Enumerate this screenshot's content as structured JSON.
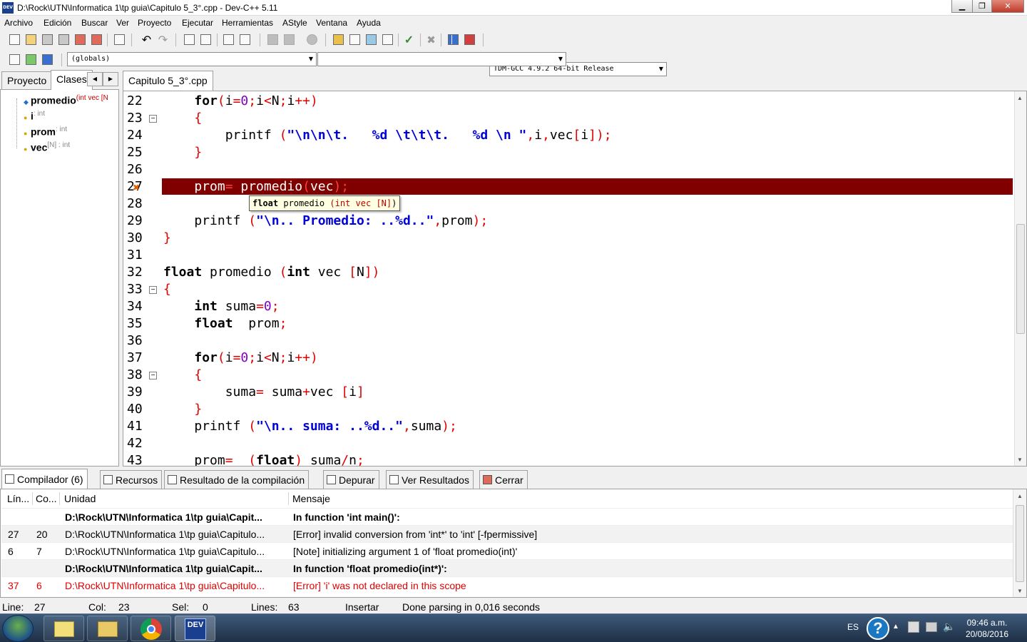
{
  "window": {
    "title": "D:\\Rock\\UTN\\Informatica 1\\tp guia\\Capitulo 5_3°.cpp - Dev-C++ 5.11",
    "app_icon_label": "DEV",
    "minimize": "▁",
    "maximize": "❐",
    "close": "✕"
  },
  "menu": [
    "Archivo",
    "Edición",
    "Buscar",
    "Ver",
    "Proyecto",
    "Ejecutar",
    "Herramientas",
    "AStyle",
    "Ventana",
    "Ayuda"
  ],
  "toolbar": {
    "compiler_select": "TDM-GCC 4.9.2 64-bit Release",
    "scope_select": "(globals)",
    "function_select": ""
  },
  "left_panel": {
    "tabs": [
      "Proyecto",
      "Clases"
    ],
    "items": [
      {
        "name": "promedio",
        "detail": "(int vec [N"
      },
      {
        "name": "i",
        "detail": ": int"
      },
      {
        "name": "prom",
        "detail": ": int"
      },
      {
        "name": "vec",
        "detail": "[N] : int"
      }
    ]
  },
  "editor": {
    "tab_label": "Capitulo 5_3°.cpp",
    "line_numbers": [
      "22",
      "23",
      "24",
      "25",
      "26",
      "27",
      "28",
      "29",
      "30",
      "31",
      "32",
      "33",
      "34",
      "35",
      "36",
      "37",
      "38",
      "39",
      "40",
      "41",
      "42",
      "43"
    ],
    "tooltip": "float promedio (int vec [N])"
  },
  "bottom_tabs": [
    "Compilador (6)",
    "Recursos",
    "Resultado de la compilación",
    "Depurar",
    "Ver Resultados",
    "Cerrar"
  ],
  "messages": {
    "headers": [
      "Lín...",
      "Co...",
      "Unidad",
      "Mensaje"
    ],
    "rows": [
      {
        "line": "",
        "col": "",
        "unit": "D:\\Rock\\UTN\\Informatica 1\\tp guia\\Capit...",
        "msg": "In function 'int main()':",
        "style": "bold"
      },
      {
        "line": "27",
        "col": "20",
        "unit": "D:\\Rock\\UTN\\Informatica 1\\tp guia\\Capitulo...",
        "msg": "[Error] invalid conversion from 'int*' to 'int' [-fpermissive]",
        "style": "normal"
      },
      {
        "line": "6",
        "col": "7",
        "unit": "D:\\Rock\\UTN\\Informatica 1\\tp guia\\Capitulo...",
        "msg": "[Note] initializing argument 1 of 'float promedio(int)'",
        "style": "normal"
      },
      {
        "line": "",
        "col": "",
        "unit": "D:\\Rock\\UTN\\Informatica 1\\tp guia\\Capit...",
        "msg": "In function 'float promedio(int*)':",
        "style": "bold"
      },
      {
        "line": "37",
        "col": "6",
        "unit": "D:\\Rock\\UTN\\Informatica 1\\tp guia\\Capitulo...",
        "msg": "[Error] 'i' was not declared in this scope",
        "style": "error"
      }
    ]
  },
  "status": {
    "line_label": "Line:",
    "line": "27",
    "col_label": "Col:",
    "col": "23",
    "sel_label": "Sel:",
    "sel": "0",
    "lines_label": "Lines:",
    "lines": "63",
    "mode": "Insertar",
    "message": "Done parsing in 0,016 seconds"
  },
  "taskbar": {
    "lang": "ES",
    "time": "09:46 a.m.",
    "date": "20/08/2016",
    "devcpp_label": "DEV"
  },
  "colors": {
    "highlight": "#800000",
    "symbol": "#e00000",
    "string": "#0000d8",
    "error_text": "#e00000"
  }
}
